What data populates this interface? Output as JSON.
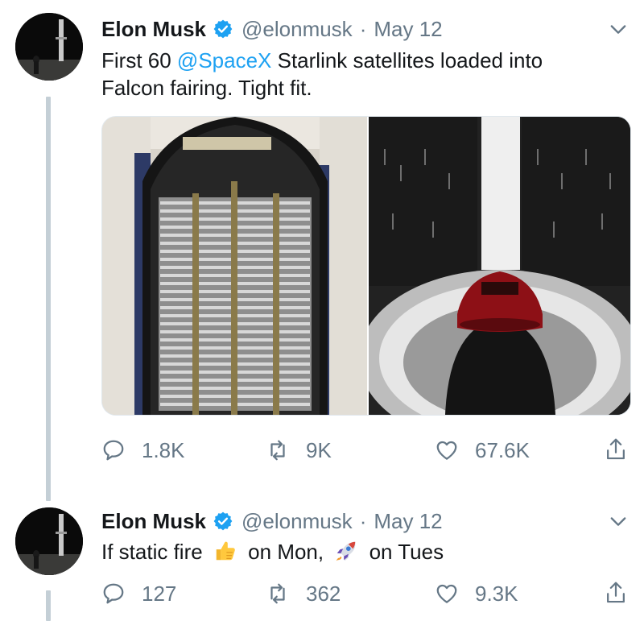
{
  "tweets": [
    {
      "author": {
        "name": "Elon Musk",
        "handle": "@elonmusk"
      },
      "separator": "·",
      "date": "May 12",
      "text": {
        "line1_before": "First 60 ",
        "mention": "@SpaceX",
        "line1_after": " Starlink satellites loaded into",
        "line2": "Falcon fairing. Tight fit."
      },
      "media": [
        {
          "icon": "starlink-satellites-photo"
        },
        {
          "icon": "tesla-roadster-fairing-photo"
        }
      ],
      "stats": {
        "replies": "1.8K",
        "retweets": "9K",
        "likes": "67.6K"
      }
    },
    {
      "author": {
        "name": "Elon Musk",
        "handle": "@elonmusk"
      },
      "separator": "·",
      "date": "May 12",
      "text": {
        "part1": "If static fire",
        "emoji1": "thumbs-up",
        "part2": "on Mon,",
        "emoji2": "rocket",
        "part3": "on Tues"
      },
      "stats": {
        "replies": "127",
        "retweets": "362",
        "likes": "9.3K"
      }
    }
  ],
  "colors": {
    "link": "#1da1f2",
    "muted": "#657786",
    "thread": "#c4cfd6",
    "verified": "#1da1f2"
  }
}
